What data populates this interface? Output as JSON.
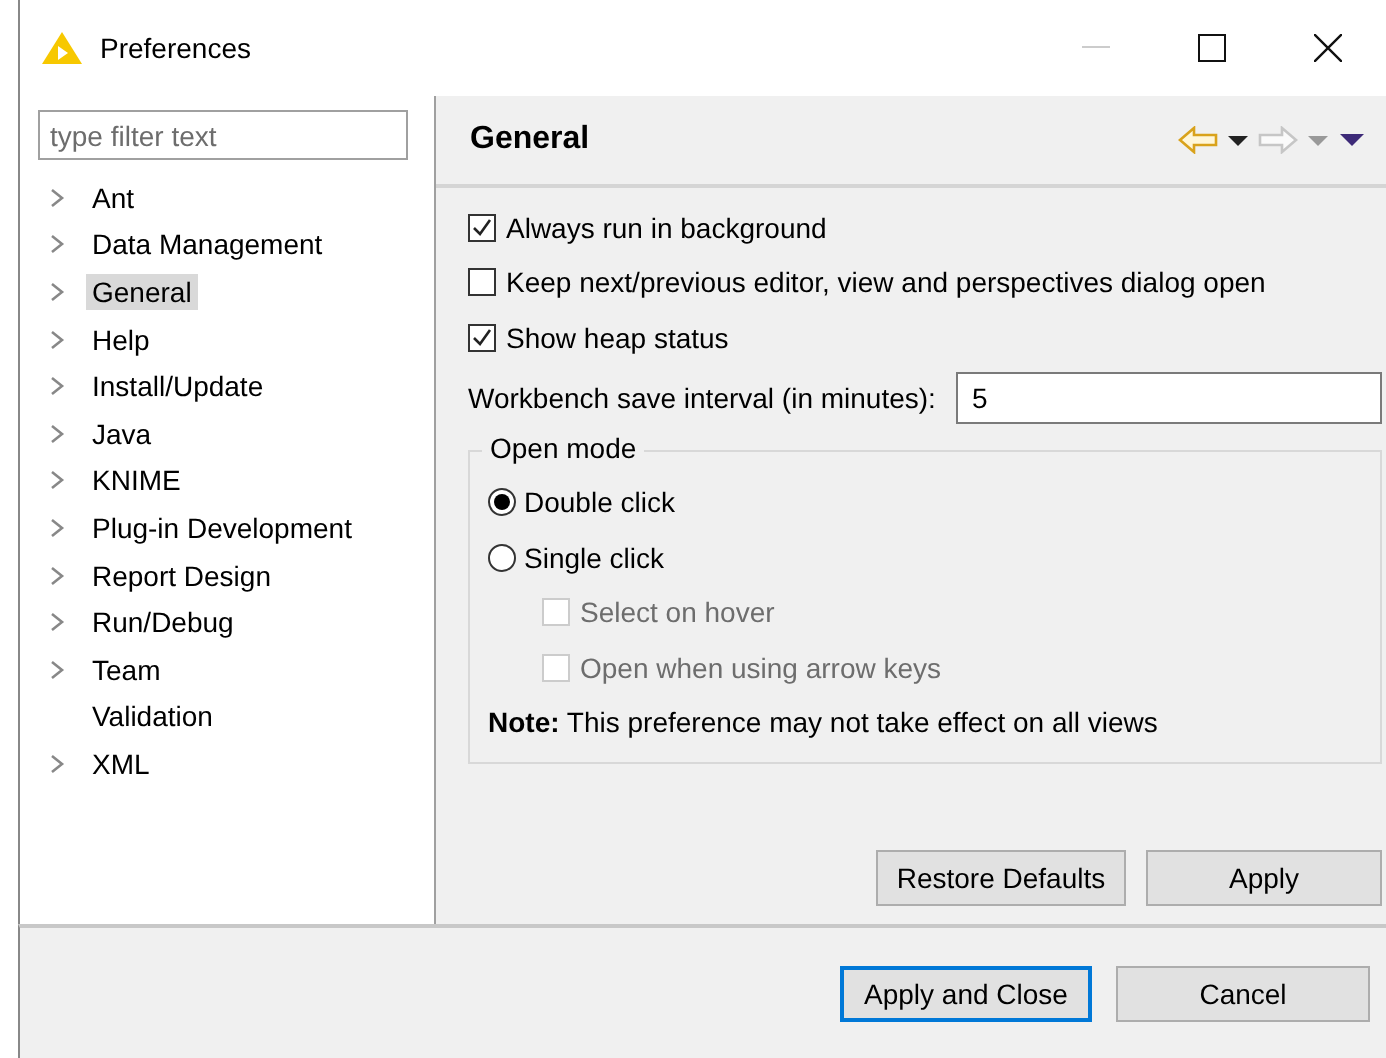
{
  "window": {
    "title": "Preferences"
  },
  "filter": {
    "placeholder": "type filter text"
  },
  "tree": [
    {
      "label": "Ant",
      "expandable": true,
      "selected": false
    },
    {
      "label": "Data Management",
      "expandable": true,
      "selected": false
    },
    {
      "label": "General",
      "expandable": true,
      "selected": true
    },
    {
      "label": "Help",
      "expandable": true,
      "selected": false
    },
    {
      "label": "Install/Update",
      "expandable": true,
      "selected": false
    },
    {
      "label": "Java",
      "expandable": true,
      "selected": false
    },
    {
      "label": "KNIME",
      "expandable": true,
      "selected": false
    },
    {
      "label": "Plug-in Development",
      "expandable": true,
      "selected": false
    },
    {
      "label": "Report Design",
      "expandable": true,
      "selected": false
    },
    {
      "label": "Run/Debug",
      "expandable": true,
      "selected": false
    },
    {
      "label": "Team",
      "expandable": true,
      "selected": false
    },
    {
      "label": "Validation",
      "expandable": false,
      "selected": false
    },
    {
      "label": "XML",
      "expandable": true,
      "selected": false
    }
  ],
  "page": {
    "title": "General",
    "options": [
      {
        "label": "Always run in background",
        "checked": true
      },
      {
        "label": "Keep next/previous editor, view and perspectives dialog open",
        "checked": false
      },
      {
        "label": "Show heap status",
        "checked": true
      }
    ],
    "save_interval": {
      "label": "Workbench save interval (in minutes):",
      "value": "5"
    },
    "open_mode": {
      "title": "Open mode",
      "radios": [
        {
          "label": "Double click",
          "selected": true
        },
        {
          "label": "Single click",
          "selected": false
        }
      ],
      "sub_options": [
        {
          "label": "Select on hover",
          "checked": false,
          "disabled": true
        },
        {
          "label": "Open when using arrow keys",
          "checked": false,
          "disabled": true
        }
      ],
      "note": "**Note:** This preference may not take effect on all views"
    },
    "buttons": [
      {
        "label": "Restore Defaults"
      },
      {
        "label": "Apply"
      }
    ]
  },
  "dialog_buttons": [
    {
      "label": "Apply and Close",
      "default": true
    },
    {
      "label": "Cancel",
      "default": false
    }
  ]
}
